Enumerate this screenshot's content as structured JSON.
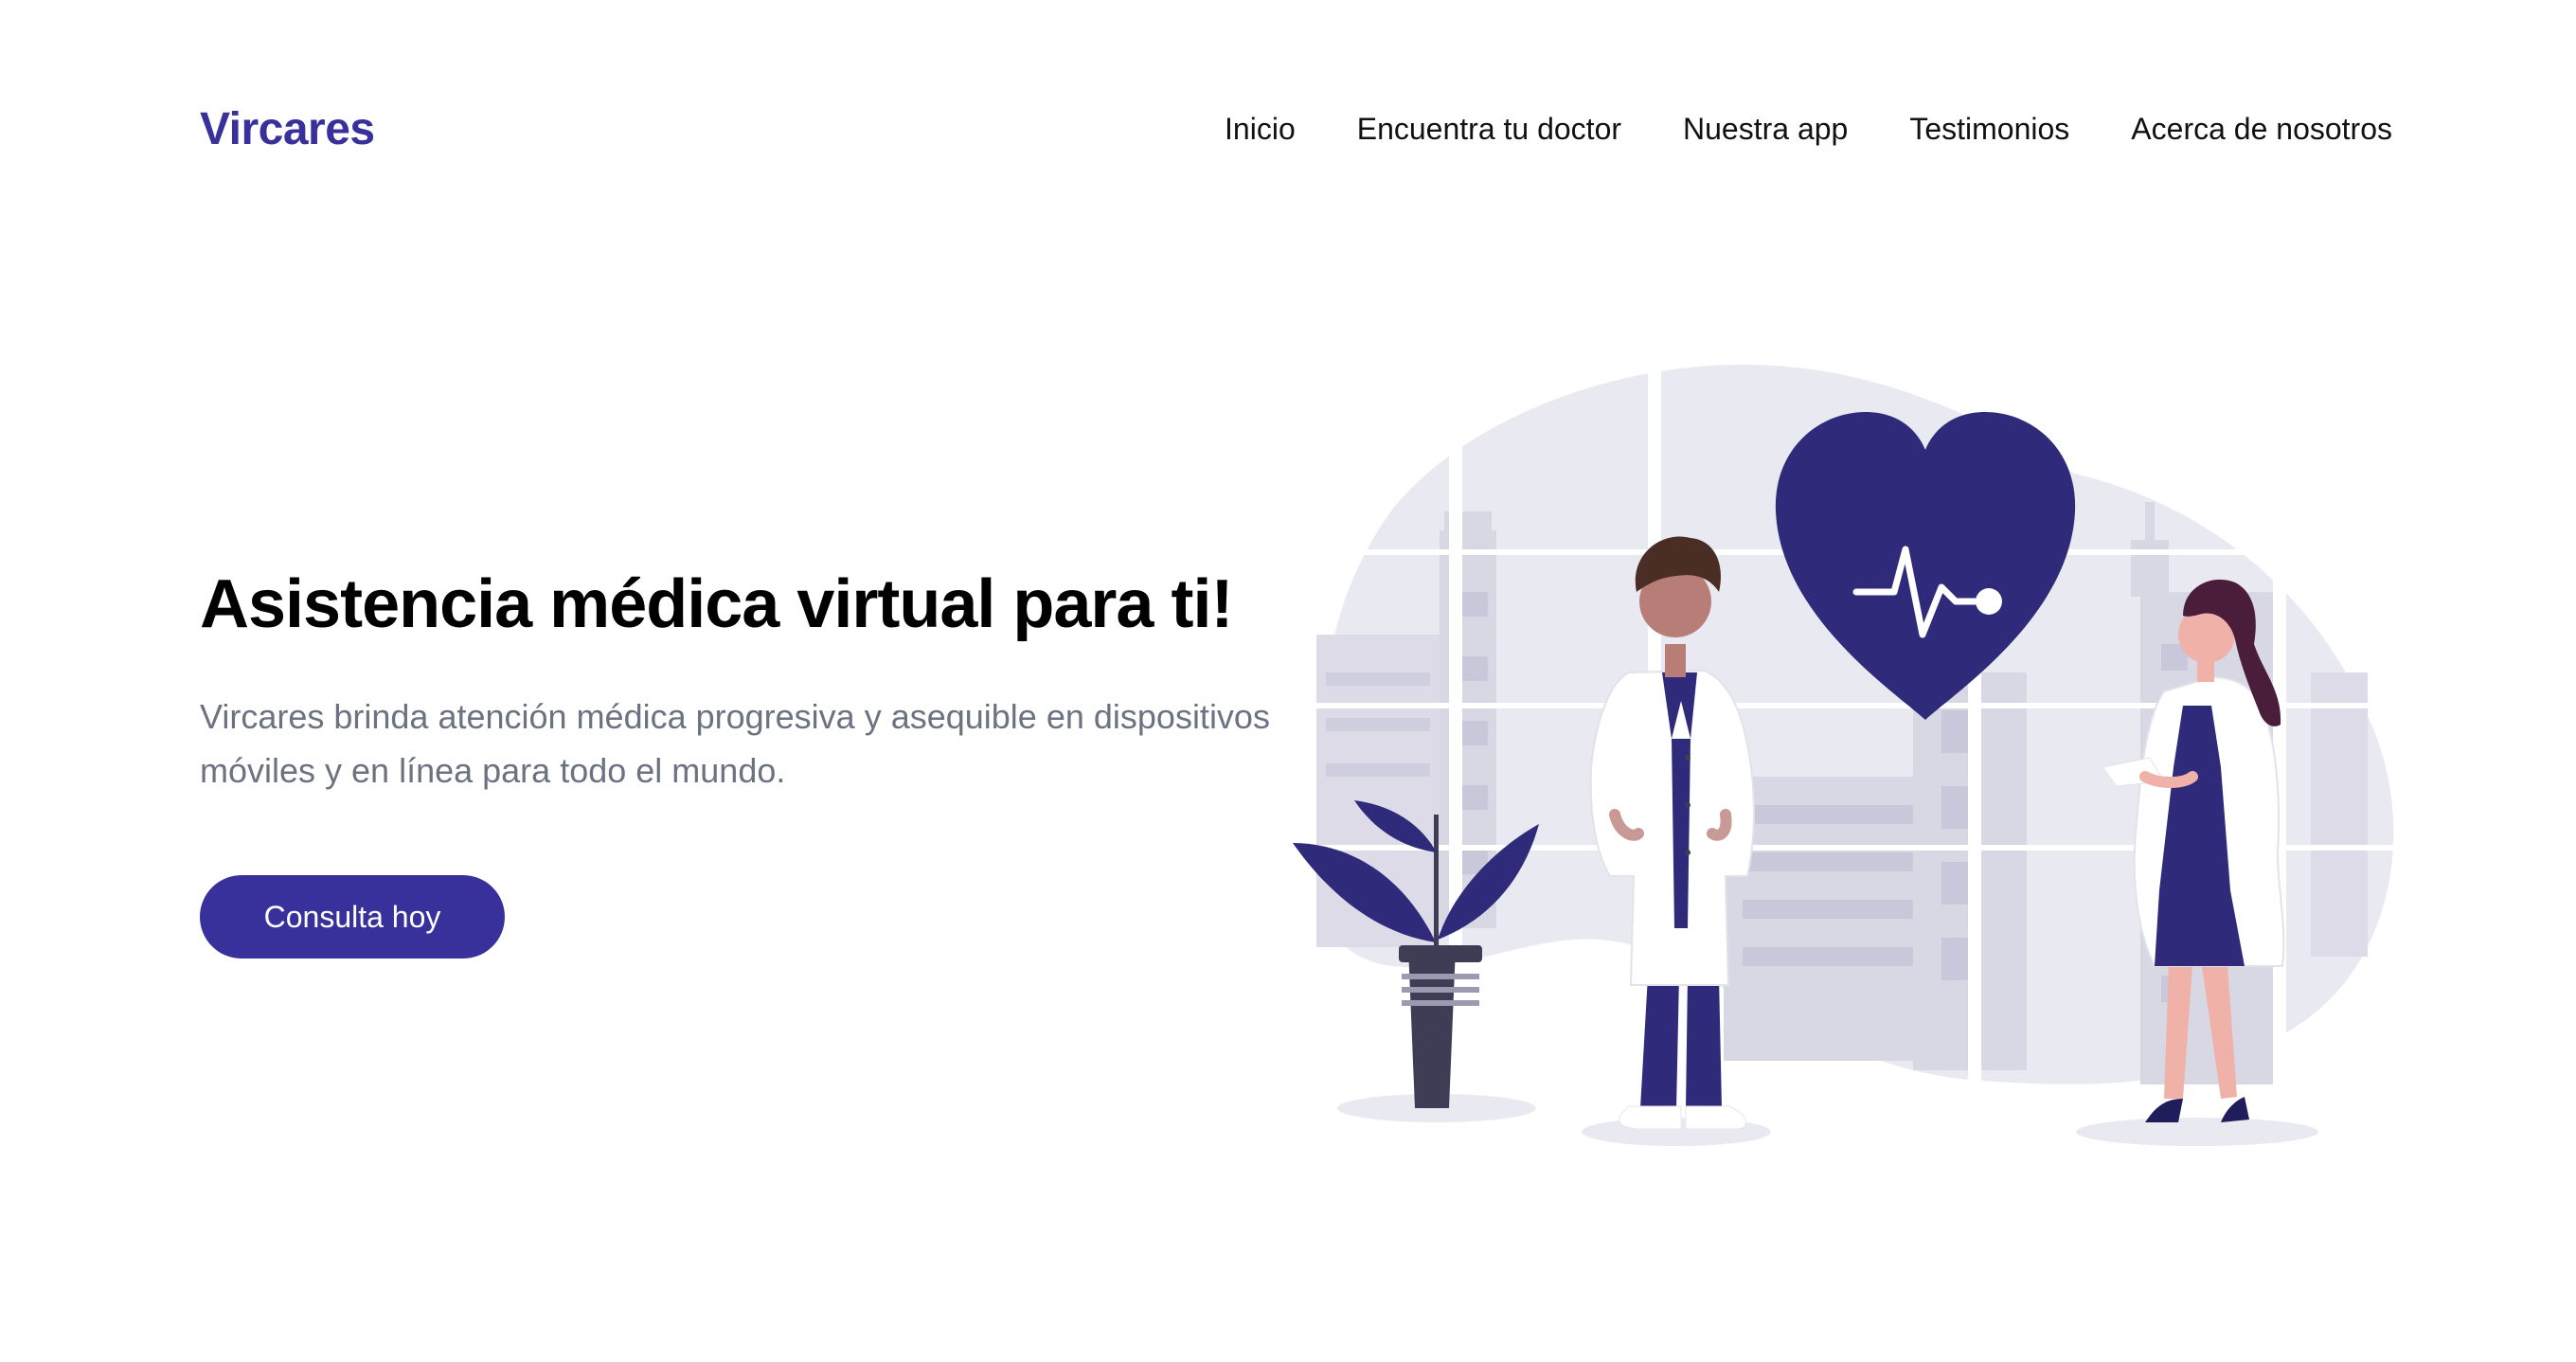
{
  "brand": {
    "name": "Vircares",
    "color": "#38309b"
  },
  "nav": {
    "items": [
      {
        "label": "Inicio"
      },
      {
        "label": "Encuentra tu doctor"
      },
      {
        "label": "Nuestra app"
      },
      {
        "label": "Testimonios"
      },
      {
        "label": "Acerca de nosotros"
      }
    ]
  },
  "hero": {
    "title": "Asistencia médica virtual para ti!",
    "description": "Vircares brinda atención médica progresiva y asequible en dispositivos móviles y en línea para todo el mundo.",
    "cta_label": "Consulta hoy"
  },
  "illustration": {
    "subject": "doctors-with-heart-illustration",
    "accent_color": "#2f2b7a",
    "background_color": "#e8e8f0"
  },
  "colors": {
    "accent": "#38309b",
    "text": "#000000",
    "muted": "#6b7280"
  }
}
